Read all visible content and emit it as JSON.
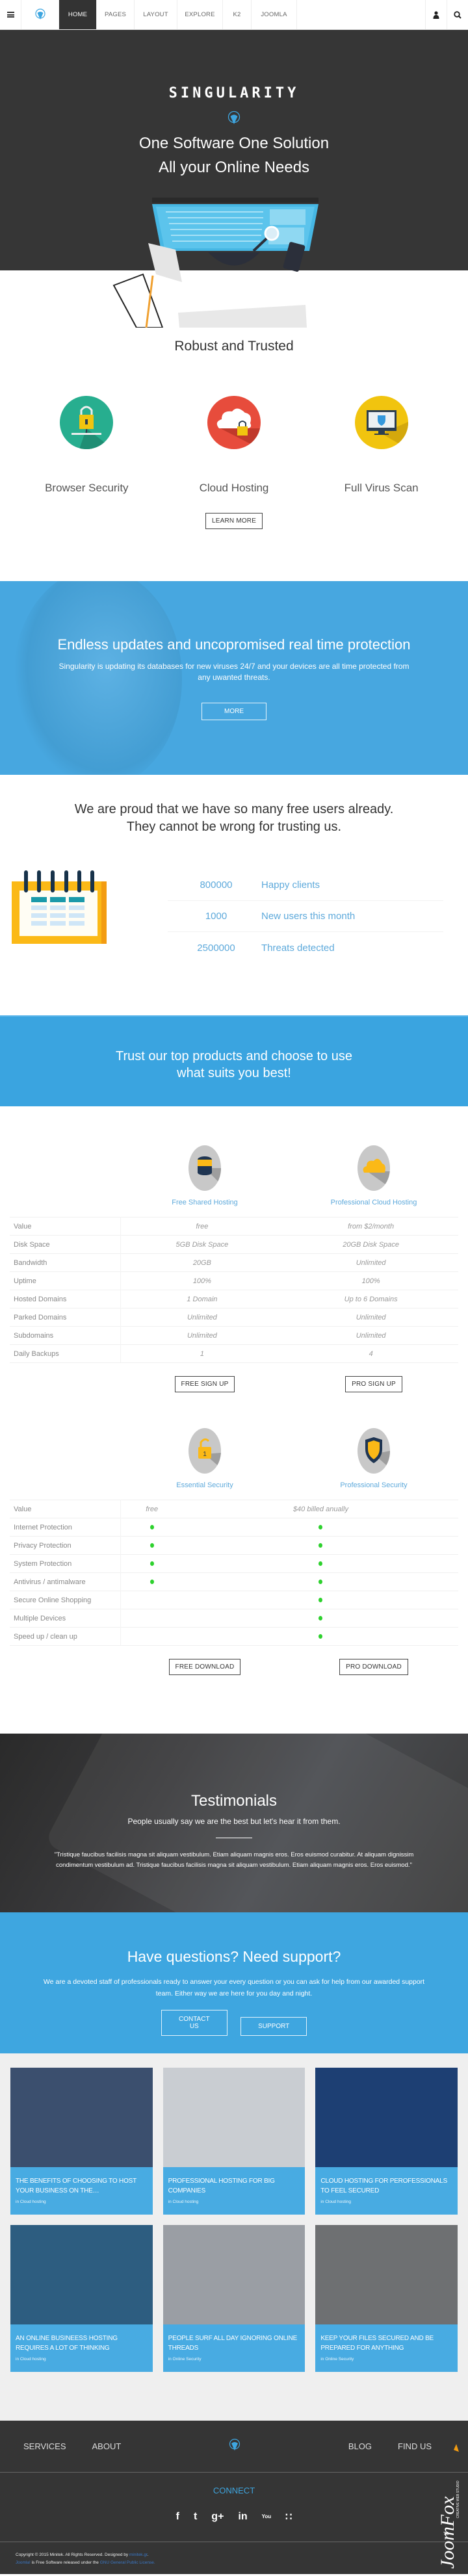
{
  "nav": {
    "items": [
      {
        "label": "HOME",
        "active": true
      },
      {
        "label": "PAGES"
      },
      {
        "label": "LAYOUT"
      },
      {
        "label": "EXPLORE"
      },
      {
        "label": "K2"
      },
      {
        "label": "JOOMLA"
      }
    ],
    "icons": [
      "menu-icon",
      "logo-pin-icon",
      "user-icon",
      "search-icon"
    ]
  },
  "hero": {
    "brand": "SINGULARITY",
    "line1": "One Software One Solution",
    "line2": "All your Online Needs"
  },
  "robust": {
    "title": "Robust and Trusted",
    "features": [
      {
        "label": "Browser Security",
        "icon": "padlock-network-icon",
        "color": "#27ae8f"
      },
      {
        "label": "Cloud Hosting",
        "icon": "cloud-lock-icon",
        "color": "#e74c3c"
      },
      {
        "label": "Full Virus Scan",
        "icon": "monitor-shield-icon",
        "color": "#f1c40f"
      }
    ],
    "button": "LEARN MORE"
  },
  "endless": {
    "title": "Endless updates and uncopromised real time protection",
    "text": "Singularity is updating its databases for new viruses 24/7 and your devices are all time protected from any uwanted threats.",
    "button": "MORE"
  },
  "proud": {
    "line1": "We are proud that we have so many free users already.",
    "line2": "They cannot be wrong for trusting us.",
    "stats": [
      {
        "value": "800000",
        "label": "Happy clients"
      },
      {
        "value": "1000",
        "label": "New users this month"
      },
      {
        "value": "2500000",
        "label": "Threats detected"
      }
    ]
  },
  "trust": {
    "line1": "Trust our top products and choose to use",
    "line2": "what suits you best!"
  },
  "hosting": {
    "plans": [
      {
        "name": "Free Shared Hosting",
        "icon": "database-icon"
      },
      {
        "name": "Professional Cloud Hosting",
        "icon": "cloud-icon"
      }
    ],
    "rows": [
      {
        "feature": "Value",
        "a": "free",
        "b": "from $2/month"
      },
      {
        "feature": "Disk Space",
        "a": "5GB Disk Space",
        "b": "20GB Disk Space"
      },
      {
        "feature": "Bandwidth",
        "a": "20GB",
        "b": "Unlimited"
      },
      {
        "feature": "Uptime",
        "a": "100%",
        "b": "100%"
      },
      {
        "feature": "Hosted Domains",
        "a": "1 Domain",
        "b": "Up to 6 Domains"
      },
      {
        "feature": "Parked Domains",
        "a": "Unlimited",
        "b": "Unlimited"
      },
      {
        "feature": "Subdomains",
        "a": "Unlimited",
        "b": "Unlimited"
      },
      {
        "feature": "Daily Backups",
        "a": "1",
        "b": "4"
      }
    ],
    "buttons": [
      "FREE SIGN UP",
      "PRO SIGN UP"
    ]
  },
  "security": {
    "plans": [
      {
        "name": "Essential Security",
        "icon": "open-padlock-icon"
      },
      {
        "name": "Professional Security",
        "icon": "shield-icon"
      }
    ],
    "value_row": {
      "feature": "Value",
      "a": "free",
      "b": "$40 billed anually"
    },
    "rows": [
      {
        "feature": "Internet Protection",
        "a": true,
        "b": true
      },
      {
        "feature": "Privacy Protection",
        "a": true,
        "b": true
      },
      {
        "feature": "System Protection",
        "a": true,
        "b": true
      },
      {
        "feature": "Antivirus / antimalware",
        "a": true,
        "b": true
      },
      {
        "feature": "Secure Online Shopping",
        "a": false,
        "b": true
      },
      {
        "feature": "Multiple Devices",
        "a": false,
        "b": true
      },
      {
        "feature": "Speed up / clean up",
        "a": false,
        "b": true
      }
    ],
    "buttons": [
      "FREE DOWNLOAD",
      "PRO DOWNLOAD"
    ]
  },
  "testimonials": {
    "title": "Testimonials",
    "subtitle": "People usually say we are the best but let's hear it from them.",
    "quote": "\"Tristique faucibus facilisis magna sit aliquam vestibulum. Etiam aliquam magnis eros. Eros euismod curabitur. At aliquam dignissim condimentum vestibulum ad. Tristique faucibus facilisis magna sit aliquam vestibulum. Etiam aliquam magnis eros. Eros euismod.\""
  },
  "support": {
    "title": "Have questions? Need support?",
    "text": "We are a devoted staff of professionals ready to answer your every question or you can ask for help from our awarded support team. Either way we are here for you day and night.",
    "buttons": [
      "CONTACT US",
      "SUPPORT"
    ]
  },
  "blog": {
    "posts": [
      {
        "title": "THE BENEFITS OF CHOOSING TO HOST YOUR BUSINESS ON THE…",
        "category": "in Cloud hosting",
        "bg": "#3b4f6e"
      },
      {
        "title": "PROFESSIONAL HOSTING FOR BIG COMPANIES",
        "category": "in Cloud hosting",
        "bg": "#c9cdd2"
      },
      {
        "title": "CLOUD HOSTING FOR PEROFESSIONALS TO FEEL SECURED",
        "category": "in Cloud hosting",
        "bg": "#1d3f73"
      },
      {
        "title": "AN ONLINE BUSINEESS HOSTING REQUIRES A LOT OF THINKING",
        "category": "in Cloud hosting",
        "bg": "#2d5d80"
      },
      {
        "title": "PEOPLE SURF ALL DAY IGNORING ONLINE THREADS",
        "category": "in Online Security",
        "bg": "#9a9ea4"
      },
      {
        "title": "KEEP YOUR FILES SECURED AND BE PREPARED FOR ANYTHING",
        "category": "in Online Security",
        "bg": "#6e7072"
      }
    ]
  },
  "footer": {
    "nav_left": [
      "SERVICES",
      "ABOUT"
    ],
    "nav_right": [
      "BLOG",
      "FIND US"
    ],
    "connect": "CONNECT",
    "social": [
      {
        "icon": "facebook-icon",
        "glyph": "f"
      },
      {
        "icon": "twitter-icon",
        "glyph": "t"
      },
      {
        "icon": "google-plus-icon",
        "glyph": "g+"
      },
      {
        "icon": "linkedin-icon",
        "glyph": "in"
      },
      {
        "icon": "youtube-icon",
        "glyph": "You"
      },
      {
        "icon": "rss-icon",
        "glyph": "∷"
      }
    ],
    "copyright_prefix": "Copyright © 2015 Minitek. All Rights Reserved. Designed by ",
    "copyright_link": "minitek.gr",
    "copyright_suffix": ".",
    "license_link1": "Joomla!",
    "license_middle": " is Free Software released under the ",
    "license_link2": "GNU General Public License.",
    "watermark": "JoomFox CREATIVE WEB STUDIO T3"
  },
  "colors": {
    "accent": "#3ea6e0",
    "dark": "#353535",
    "check": "#2ed12e"
  }
}
